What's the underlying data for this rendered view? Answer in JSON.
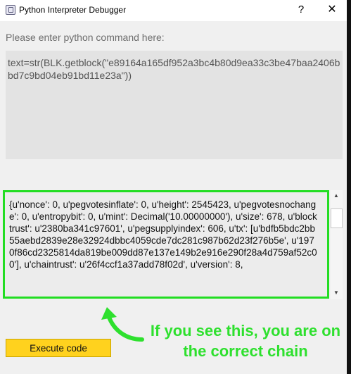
{
  "window": {
    "title": "Python Interpreter Debugger",
    "help_label": "?",
    "close_label": "✕"
  },
  "prompt": "Please enter python command here:",
  "command": "text=str(BLK.getblock(\"e89164a165df952a3bc4b80d9ea33c3be47baa2406bbd7c9bd04eb91bd11e23a\"))",
  "output": "{u'nonce': 0, u'pegvotesinflate': 0, u'height': 2545423, u'pegvotesnochange': 0, u'entropybit': 0, u'mint': Decimal('10.00000000'), u'size': 678, u'blocktrust': u'2380ba341c97601', u'pegsupplyindex': 606, u'tx': [u'bdfb5bdc2bb55aebd2839e28e32924dbbc4059cde7dc281c987b62d23f276b5e', u'1970f86cd2325814da819be009dd87e137e149b2e916e290f28a4d759af52c00'], u'chaintrust': u'26f4ccf1a37add78f02d', u'version': 8,",
  "execute_label": "Execute code",
  "callout": "If you see this, you are on the correct chain",
  "colors": {
    "highlight": "#22dd22",
    "button": "#ffd21e"
  },
  "icons": {
    "app": "app-icon",
    "help": "help-icon",
    "close": "close-icon",
    "arrow": "arrow-icon"
  }
}
